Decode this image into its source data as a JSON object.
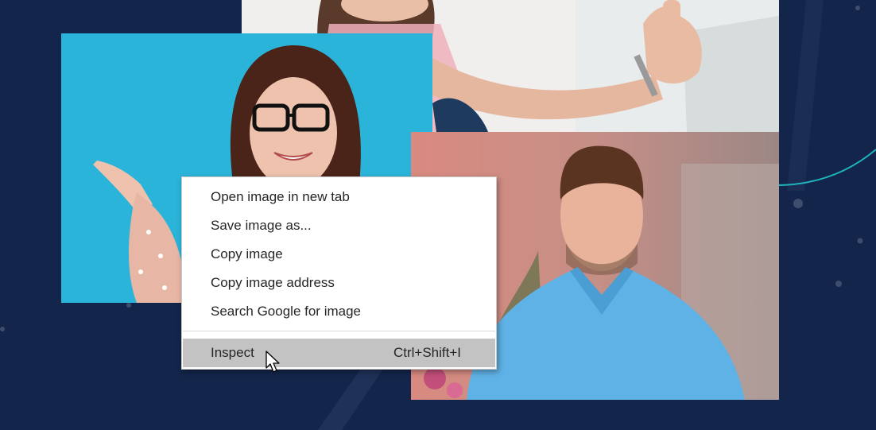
{
  "context_menu": {
    "items": [
      {
        "label": "Open image in new tab"
      },
      {
        "label": "Save image as..."
      },
      {
        "label": "Copy image"
      },
      {
        "label": "Copy image address"
      },
      {
        "label": "Search Google for image"
      }
    ],
    "inspect": {
      "label": "Inspect",
      "shortcut": "Ctrl+Shift+I"
    }
  },
  "colors": {
    "page_background": "#13254a",
    "accent_line": "#1fb5bd",
    "menu_hover": "#c3c3c3"
  },
  "icons": {
    "cursor": "arrow-pointer-icon"
  }
}
